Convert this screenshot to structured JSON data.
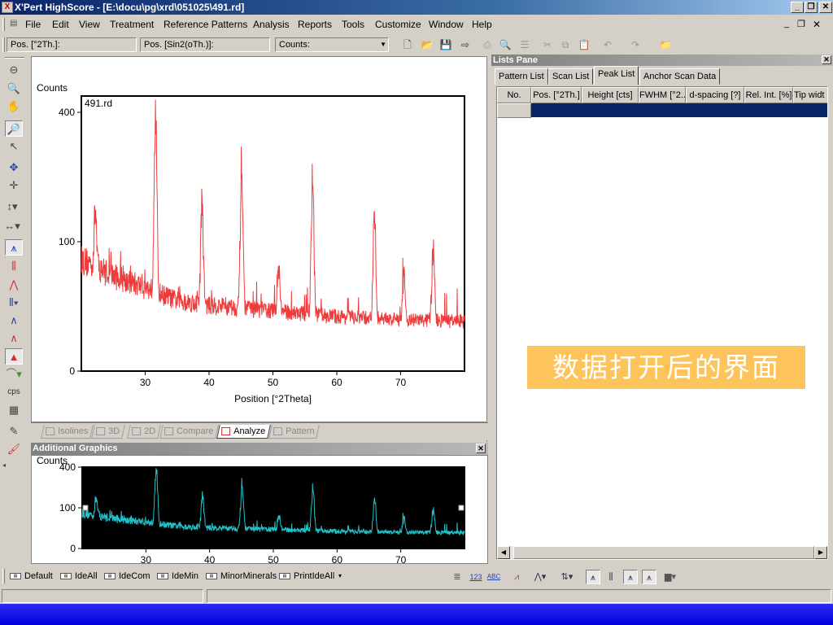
{
  "window": {
    "title": "X'Pert HighScore - [E:\\docu\\pg\\xrd\\051025\\491.rd]",
    "app_icon": "X"
  },
  "menu": [
    "File",
    "Edit",
    "View",
    "Treatment",
    "Reference Patterns",
    "Analysis",
    "Reports",
    "Tools",
    "Customize",
    "Window",
    "Help"
  ],
  "toolbar": {
    "pos_2th_label": "Pos. [°2Th.]:",
    "pos_sin_label": "Pos. [Sin2(oTh.)]:",
    "counts_label": "Counts:"
  },
  "graph_tabs": [
    "Isolines",
    "3D",
    "2D",
    "Compare",
    "Analyze",
    "Pattern"
  ],
  "active_graph_tab": "Analyze",
  "main_chart": {
    "chart_data": {
      "type": "line",
      "title": "491.rd",
      "ylabel": "Counts",
      "xlabel": "Position [°2Theta]",
      "x_ticks": [
        30,
        40,
        50,
        60,
        70
      ],
      "y_ticks": [
        "0",
        "100",
        "400"
      ],
      "y_tick_values": [
        0,
        100,
        400
      ],
      "xlim": [
        20,
        80
      ],
      "y_scale": "sqrt",
      "color": "#ee3b3b",
      "background": "#ffffff",
      "peaks": [
        {
          "x": 22.2,
          "y": 155
        },
        {
          "x": 31.6,
          "y": 430
        },
        {
          "x": 38.9,
          "y": 165
        },
        {
          "x": 45.1,
          "y": 245
        },
        {
          "x": 50.9,
          "y": 67
        },
        {
          "x": 56.2,
          "y": 210
        },
        {
          "x": 65.9,
          "y": 140
        },
        {
          "x": 70.5,
          "y": 54
        },
        {
          "x": 75.1,
          "y": 85
        }
      ],
      "background_curve": [
        [
          20,
          75
        ],
        [
          25,
          55
        ],
        [
          30,
          42
        ],
        [
          35,
          30
        ],
        [
          40,
          26
        ],
        [
          50,
          22
        ],
        [
          60,
          18
        ],
        [
          70,
          16
        ],
        [
          80,
          15
        ]
      ]
    }
  },
  "additional_graphics": {
    "title": "Additional Graphics",
    "chart_data": {
      "type": "line",
      "ylabel": "Counts",
      "x_ticks": [
        30,
        40,
        50,
        60,
        70
      ],
      "y_ticks": [
        "0",
        "100",
        "400"
      ],
      "y_tick_values": [
        0,
        100,
        400
      ],
      "xlim": [
        20,
        80
      ],
      "y_scale": "sqrt",
      "color": "#22c0c8",
      "background": "#000000"
    }
  },
  "lists_pane": {
    "title": "Lists Pane",
    "tabs": [
      "Pattern List",
      "Scan List",
      "Peak List",
      "Anchor Scan Data"
    ],
    "active_tab": "Peak List",
    "columns": [
      "No.",
      "Pos. [°2Th.]",
      "Height [cts]",
      "FWHM [°2...",
      "d-spacing [?]",
      "Rel. Int. [%]",
      "Tip widt"
    ]
  },
  "overlay_caption": "数据打开后的界面",
  "bottom_toolbar": [
    "Default",
    "IdeAll",
    "IdeCom",
    "IdeMin",
    "MinorMinerals",
    "PrintIdeAll"
  ],
  "icons": {
    "left_tools": [
      "zoom-out-icon",
      "zoom-icon",
      "pan-hand-icon",
      "magnifier-icon",
      "pointer-icon",
      "move-icon",
      "crosshair-icon",
      "y-scale-icon",
      "x-scale-icon",
      "analyze-peaks-icon",
      "peak-bars-icon",
      "profile-icon",
      "stick-pattern-icon",
      "peak-shape-icon",
      "fit-icon",
      "cps-icon",
      "grid-icon",
      "pen-icon",
      "brush-icon"
    ],
    "cps_text": "cps",
    "bottom_digits": "123",
    "bottom_abc": "ABC"
  }
}
